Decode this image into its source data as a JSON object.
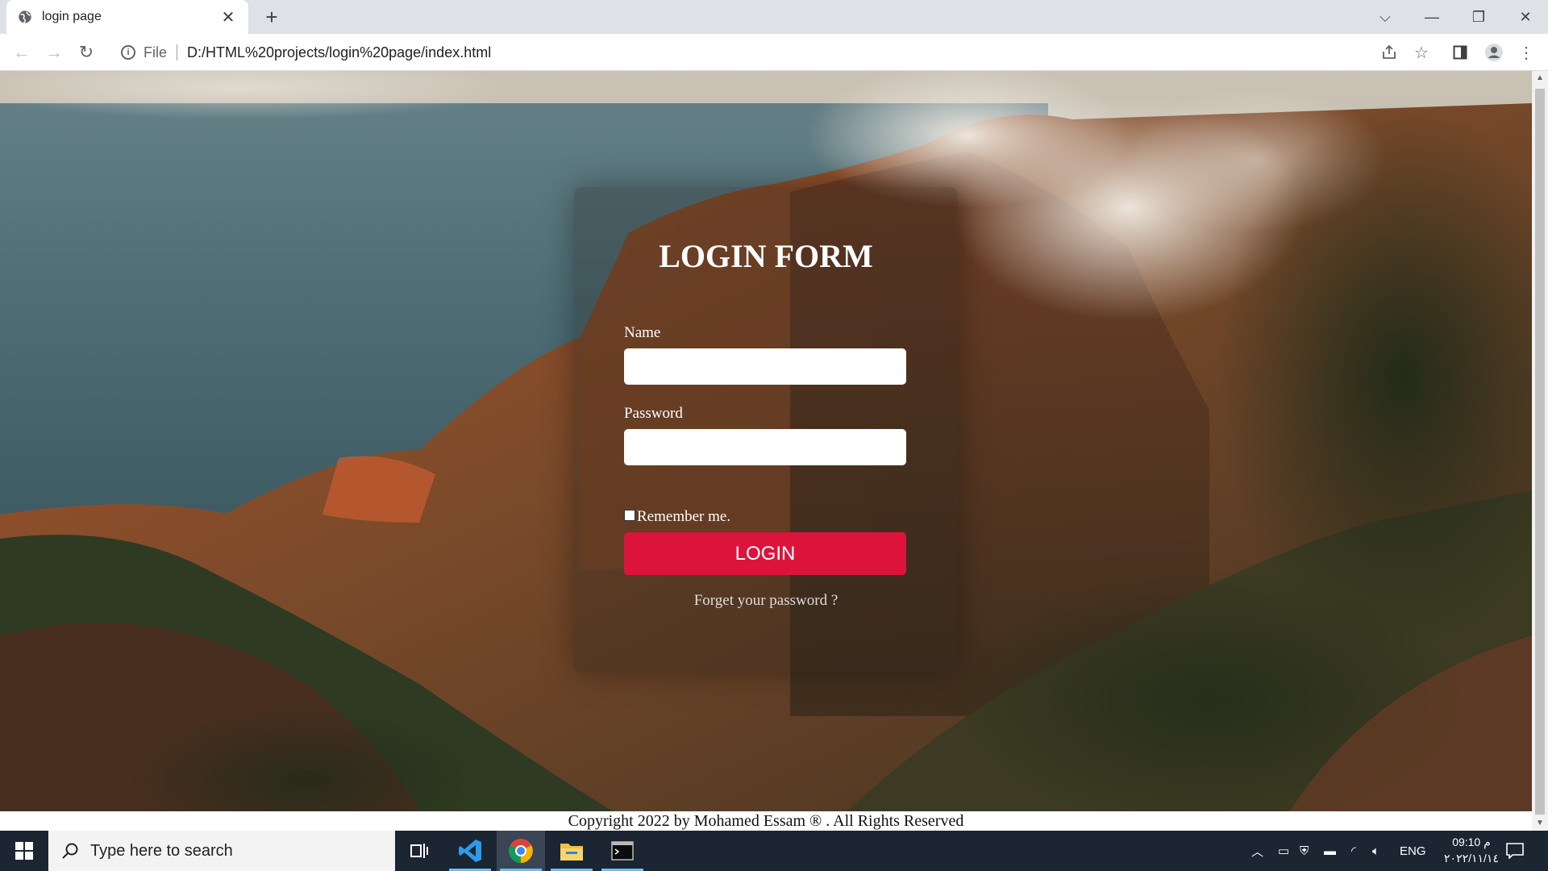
{
  "browser": {
    "tab_title": "login page",
    "tab_icon": "globe-icon",
    "omnibox": {
      "scheme_label": "File",
      "url": "D:/HTML%20projects/login%20page/index.html"
    }
  },
  "login_form": {
    "title": "LOGIN FORM",
    "name_label": "Name",
    "name_value": "",
    "password_label": "Password",
    "password_value": "",
    "remember_label": "Remember me.",
    "remember_checked": false,
    "login_button": "LOGIN",
    "forgot_link": "Forget your password ?",
    "button_color": "#dc143c"
  },
  "footer": {
    "copyright": "Copyright 2022 by Mohamed Essam ® . All Rights Reserved"
  },
  "taskbar": {
    "search_placeholder": "Type here to search",
    "apps": [
      "task-view",
      "vscode",
      "chrome",
      "file-explorer",
      "terminal"
    ],
    "active_app": "chrome",
    "language": "ENG",
    "time": "09:10 م",
    "date": "٢٠٢٢/١١/١٤"
  }
}
